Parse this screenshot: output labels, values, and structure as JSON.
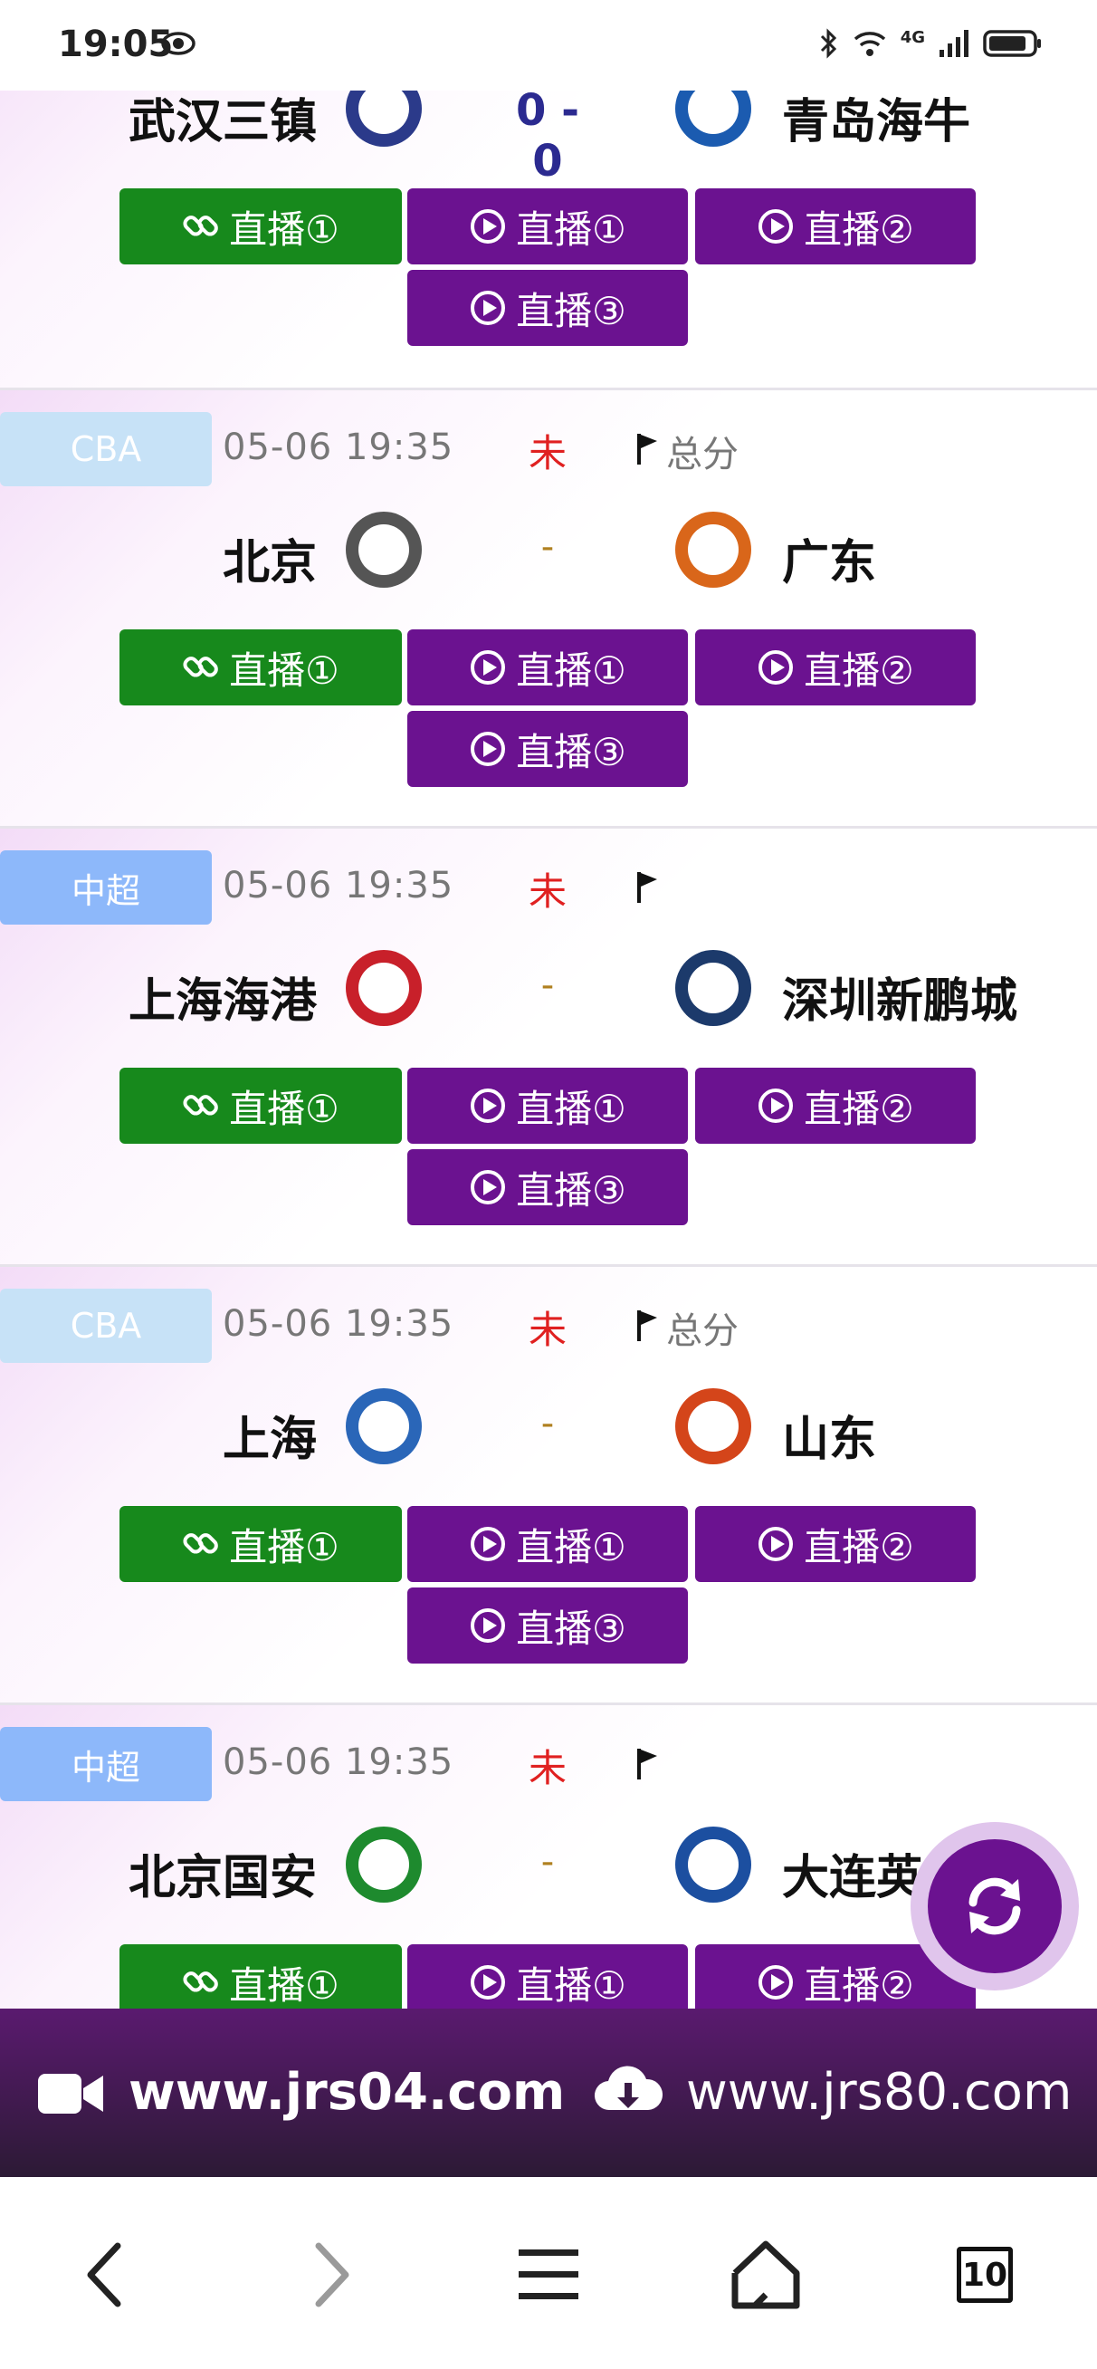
{
  "status_bar": {
    "time": "19:05",
    "network": "4G"
  },
  "buttons": {
    "link1": "直播①",
    "play1": "直播①",
    "play2": "直播②",
    "play3": "直播③"
  },
  "matches": [
    {
      "league": "",
      "datetime": "",
      "status": "",
      "extra": "",
      "home": "武汉三镇",
      "away": "青岛海牛",
      "score": "0 - 0"
    },
    {
      "league": "CBA",
      "datetime": "05-06 19:35",
      "status": "未",
      "extra": "总分",
      "home": "北京",
      "away": "广东",
      "score": "-"
    },
    {
      "league": "中超",
      "datetime": "05-06 19:35",
      "status": "未",
      "extra": "",
      "home": "上海海港",
      "away": "深圳新鹏城",
      "score": "-"
    },
    {
      "league": "CBA",
      "datetime": "05-06 19:35",
      "status": "未",
      "extra": "总分",
      "home": "上海",
      "away": "山东",
      "score": "-"
    },
    {
      "league": "中超",
      "datetime": "05-06 19:35",
      "status": "未",
      "extra": "",
      "home": "北京国安",
      "away": "大连英博",
      "score": "-"
    }
  ],
  "banner": {
    "site1": "www.jrs04.com",
    "site2": "www.jrs80.com"
  },
  "navbar": {
    "tabs_count": "10"
  },
  "colors": {
    "accent_purple": "#6b1290",
    "live_green": "#17891c",
    "status_red": "#e02020"
  }
}
